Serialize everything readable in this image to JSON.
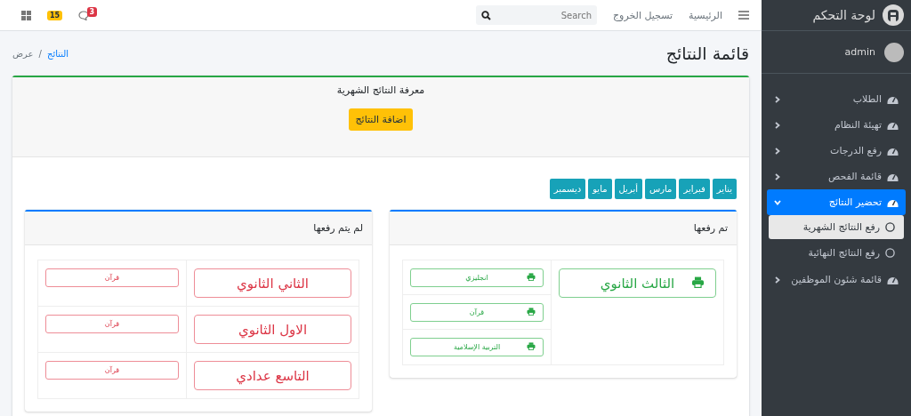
{
  "sidebar": {
    "brand": "لوحة التحكم",
    "user": "admin",
    "items": [
      {
        "label": "الطلاب",
        "selected": false,
        "expanded": false
      },
      {
        "label": "تهيئة النظام",
        "selected": false,
        "expanded": false
      },
      {
        "label": "رفع الدرجات",
        "selected": false,
        "expanded": false
      },
      {
        "label": "قائمة الفحص",
        "selected": false,
        "expanded": false
      },
      {
        "label": "تحضير النتائج",
        "selected": true,
        "expanded": true,
        "children": [
          {
            "label": "رفع النتائج الشهرية",
            "selected": true
          },
          {
            "label": "رفع النتائج النهائية",
            "selected": false
          }
        ]
      },
      {
        "label": "قائمة شئون الموظفين",
        "selected": false,
        "expanded": false
      }
    ]
  },
  "topbar": {
    "links": [
      "الرئيسية",
      "تسجيل الخروج"
    ],
    "search": {
      "placeholder": "Search"
    },
    "messages_badge": "3",
    "notifications_badge": "15"
  },
  "page": {
    "title": "قائمة النتائج",
    "breadcrumb": [
      "النتائج",
      "عرض"
    ],
    "breadcrumb_separator": "/"
  },
  "card": {
    "title": "معرفة النتائج الشهرية",
    "add_button": "اضافة النتائج",
    "months": [
      "يناير",
      "فبراير",
      "مارس",
      "أبريل",
      "مايو",
      "ديسمبر"
    ],
    "panels": [
      {
        "title": "تم رفعها",
        "kind": "uploaded",
        "rows": [
          {
            "grade": "الثالث الثانوي",
            "subjects": [
              "انجليزي",
              "قرآن",
              "التربية الإسلامية"
            ]
          }
        ]
      },
      {
        "title": "لم يتم رفعها",
        "kind": "pending",
        "rows": [
          {
            "grade": "الثاني الثانوي",
            "subjects": [
              "قرآن"
            ]
          },
          {
            "grade": "الاول الثانوي",
            "subjects": [
              "قرآن"
            ]
          },
          {
            "grade": "التاسع عدادي",
            "subjects": [
              "قرآن"
            ]
          }
        ]
      }
    ]
  }
}
